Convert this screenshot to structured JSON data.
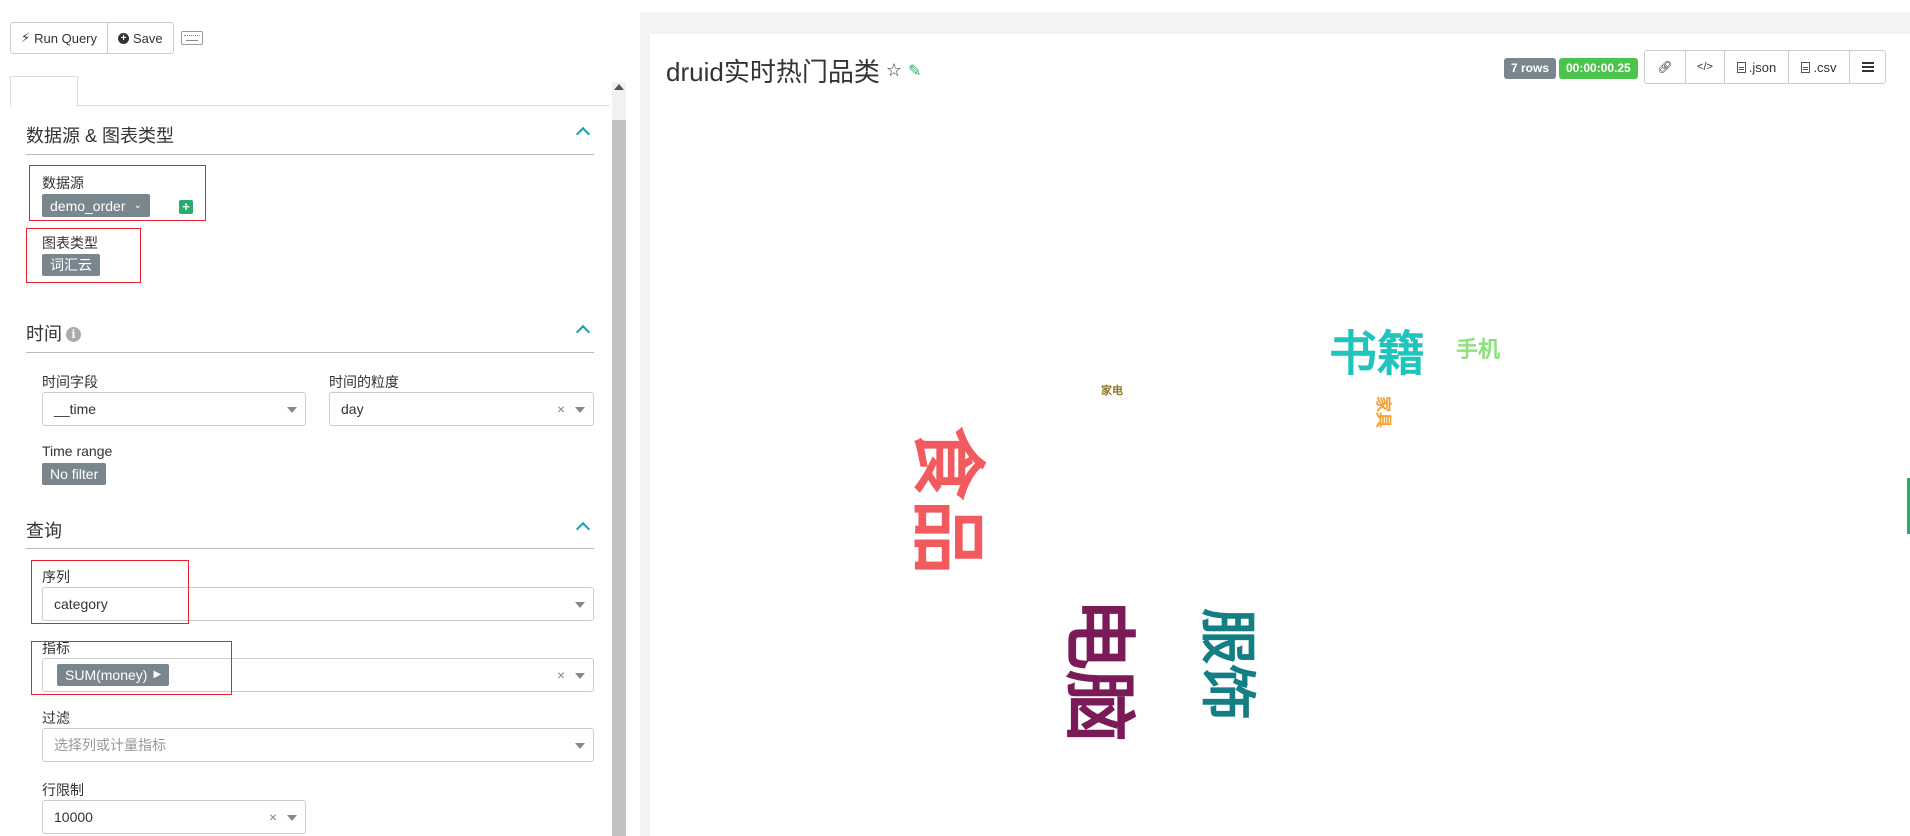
{
  "toolbar": {
    "run_query_label": "Run Query",
    "save_label": "Save"
  },
  "sections": {
    "datasource": {
      "title": "数据源 & 图表类型",
      "datasource_label": "数据源",
      "datasource_value": "demo_order",
      "viz_type_label": "图表类型",
      "viz_type_value": "词汇云"
    },
    "time": {
      "title": "时间",
      "time_column_label": "时间字段",
      "time_column_value": "__time",
      "time_grain_label": "时间的粒度",
      "time_grain_value": "day",
      "time_range_label": "Time range",
      "time_range_value": "No filter"
    },
    "query": {
      "title": "查询",
      "series_label": "序列",
      "series_value": "category",
      "metric_label": "指标",
      "metric_value": "SUM(money)",
      "filter_label": "过滤",
      "filter_placeholder": "选择列或计量指标",
      "row_limit_label": "行限制",
      "row_limit_value": "10000"
    }
  },
  "chart": {
    "title": "druid实时热门品类",
    "rows_badge": "7 rows",
    "time_badge": "00:00:00.25",
    "json_label": ".json",
    "csv_label": ".csv",
    "colors": {
      "rows_badge": "#79868e",
      "time_badge": "#4bc44b"
    }
  },
  "chart_data": {
    "type": "wordcloud",
    "words": [
      {
        "text": "电脑",
        "color": "#7a1a56",
        "rotation": "vertical"
      },
      {
        "text": "食品",
        "color": "#f15b5f",
        "rotation": "vertical"
      },
      {
        "text": "服饰",
        "color": "#137e83",
        "rotation": "vertical"
      },
      {
        "text": "书籍",
        "color": "#1fc4be",
        "rotation": "horizontal"
      },
      {
        "text": "手机",
        "color": "#8be07a",
        "rotation": "horizontal"
      },
      {
        "text": "家具",
        "color": "#f3a02f",
        "rotation": "vertical"
      },
      {
        "text": "家电",
        "color": "#8d7a1e",
        "rotation": "horizontal"
      }
    ]
  }
}
